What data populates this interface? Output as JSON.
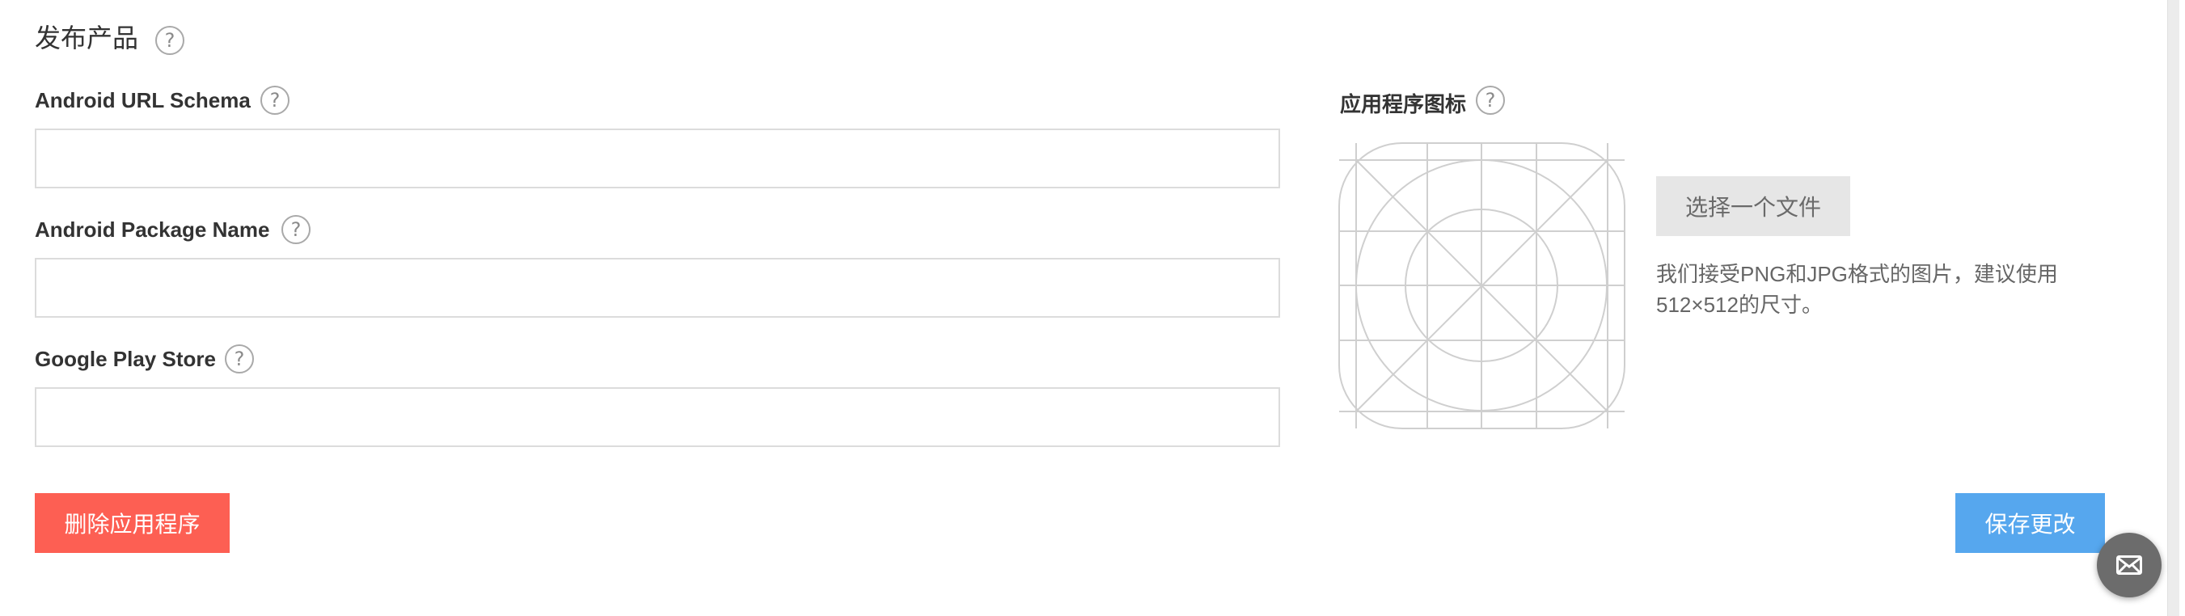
{
  "section": {
    "title": "发布产品",
    "help_glyph": "?"
  },
  "fields": {
    "android_url_schema": {
      "label": "Android URL Schema",
      "value": "",
      "placeholder": ""
    },
    "android_package_name": {
      "label": "Android Package Name",
      "value": "",
      "placeholder": ""
    },
    "google_play_store": {
      "label": "Google Play Store",
      "value": "",
      "placeholder": ""
    }
  },
  "app_icon": {
    "label": "应用程序图标",
    "choose_file_label": "选择一个文件",
    "hint": "我们接受PNG和JPG格式的图片，建议使用512×512的尺寸。",
    "placeholder_icon": "app-icon-grid"
  },
  "actions": {
    "delete_label": "删除应用程序",
    "save_label": "保存更改"
  },
  "colors": {
    "delete_button": "#fd5f53",
    "save_button": "#56a7ee",
    "choose_file_button": "#e6e6e6",
    "chat_button": "#6c6c6c"
  },
  "chat": {
    "icon": "mail-icon"
  }
}
